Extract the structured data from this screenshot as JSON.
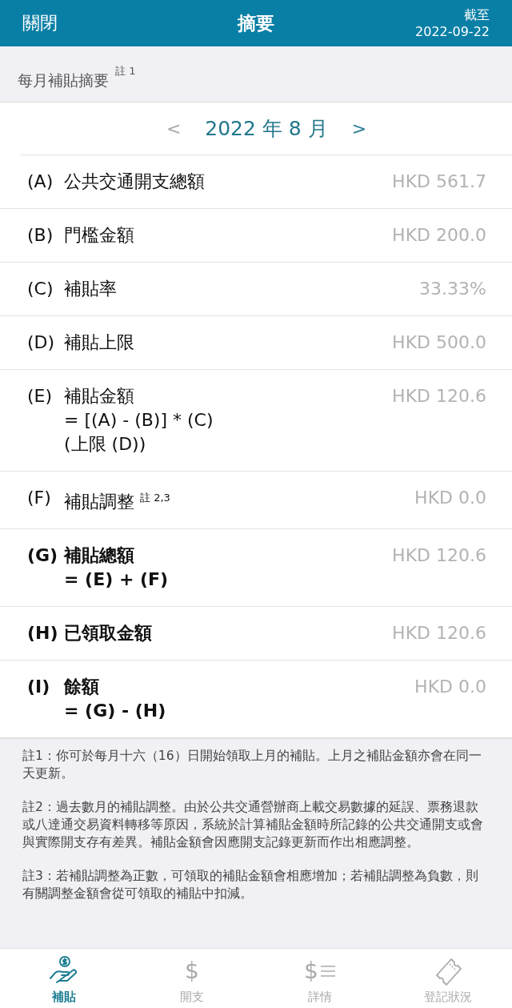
{
  "header": {
    "close": "關閉",
    "title": "摘要",
    "as_of_label": "截至",
    "as_of_date": "2022-09-22"
  },
  "section": {
    "title": "每月補貼摘要",
    "note_ref": "註 1"
  },
  "month": {
    "prev": "<",
    "label": "2022 年 8 月",
    "next": ">"
  },
  "rows": [
    {
      "code": "(A)",
      "label": "公共交通開支總額",
      "value": "HKD 561.7",
      "bold": false
    },
    {
      "code": "(B)",
      "label": "門檻金額",
      "value": "HKD 200.0",
      "bold": false
    },
    {
      "code": "(C)",
      "label": "補貼率",
      "value": "33.33%",
      "bold": false
    },
    {
      "code": "(D)",
      "label": "補貼上限",
      "value": "HKD 500.0",
      "bold": false
    },
    {
      "code": "(E)",
      "label": "補貼金額",
      "formula": [
        "= [(A) - (B)] * (C)",
        "(上限 (D))"
      ],
      "value": "HKD 120.6",
      "bold": false
    },
    {
      "code": "(F)",
      "label": "補貼調整 $^{註 2,3}$",
      "value": "HKD 0.0",
      "bold": false
    },
    {
      "code": "(G)",
      "label": "補貼總額",
      "formula": [
        "= (E) + (F)"
      ],
      "value": "HKD 120.6",
      "bold": true
    },
    {
      "code": "(H)",
      "label": "已領取金額",
      "value": "HKD 120.6",
      "bold": true
    },
    {
      "code": "(I)",
      "label": "餘額",
      "formula": [
        "= (G) - (H)"
      ],
      "value": "HKD 0.0",
      "bold": true
    }
  ],
  "notes": [
    "註1：你可於每月十六（16）日開始領取上月的補貼。上月之補貼金額亦會在同一天更新。",
    "註2：過去數月的補貼調整。由於公共交通營辦商上載交易數據的延誤、票務退款或八達通交易資料轉移等原因，系統於計算補貼金額時所記錄的公共交通開支或會與實際開支存有差異。補貼金額會因應開支記錄更新而作出相應調整。",
    "註3：若補貼調整為正數，可領取的補貼金額會相應增加；若補貼調整為負數，則有關調整金額會從可領取的補貼中扣減。"
  ],
  "tabs": [
    {
      "label": "補貼",
      "kind": "hand",
      "selected": true
    },
    {
      "label": "開支",
      "kind": "dollar",
      "glyph": "$",
      "selected": false
    },
    {
      "label": "詳情",
      "kind": "dollar-list",
      "glyph": "$",
      "selected": false
    },
    {
      "label": "登記狀況",
      "kind": "ticket",
      "selected": false
    }
  ]
}
